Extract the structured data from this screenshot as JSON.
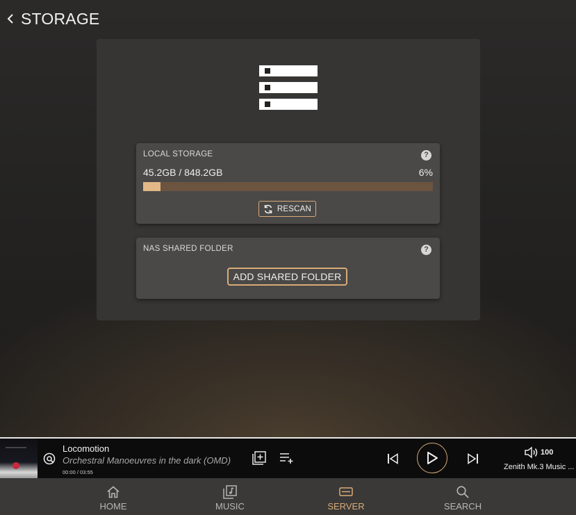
{
  "header": {
    "title": "STORAGE"
  },
  "local_storage": {
    "title": "LOCAL STORAGE",
    "usage": "45.2GB / 848.2GB",
    "percent_label": "6%",
    "used_fraction": 0.06,
    "rescan_label": "RESCAN"
  },
  "nas": {
    "title": "NAS SHARED FOLDER",
    "add_label": "ADD SHARED FOLDER"
  },
  "player": {
    "title": "Locomotion",
    "artist": "Orchestral Manoeuvres in the dark (OMD)",
    "time": "00:00 / 03:55",
    "volume": "100",
    "device": "Zenith Mk.3 Music ..."
  },
  "nav": [
    {
      "label": "HOME",
      "icon": "home-icon"
    },
    {
      "label": "MUSIC",
      "icon": "music-library-icon"
    },
    {
      "label": "SERVER",
      "icon": "server-icon"
    },
    {
      "label": "SEARCH",
      "icon": "search-icon"
    }
  ],
  "colors": {
    "accent": "#d9ab77",
    "progress_fill": "#e3b887",
    "progress_track": "#6b5440"
  }
}
